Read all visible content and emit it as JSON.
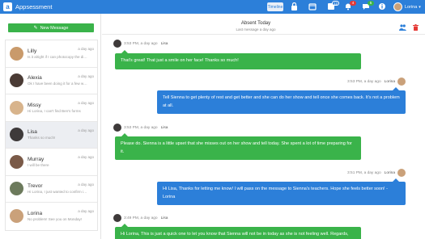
{
  "app": {
    "name": "Appsessment",
    "logo_letter": "a"
  },
  "topbar": {
    "timeline_label": "Timeline",
    "badges": {
      "notifications_a": "12",
      "notifications_b": "4",
      "messages": "5"
    },
    "user_name": "Lorina"
  },
  "sidebar": {
    "new_message_label": "New Message",
    "contacts": [
      {
        "name": "Lilly",
        "preview": "Is it alright if I can photocopy the dis...",
        "time": "a day ago"
      },
      {
        "name": "Alexia",
        "preview": "Ok I have been doing it for a few weeks...",
        "time": "a day ago"
      },
      {
        "name": "Missy",
        "preview": "Hi Lorina, I can't find Ben's forms",
        "time": "a day ago"
      },
      {
        "name": "Lisa",
        "preview": "Thanks so much!",
        "time": "a day ago"
      },
      {
        "name": "Murray",
        "preview": "I will be there",
        "time": "a day ago"
      },
      {
        "name": "Trevor",
        "preview": "Hi Lorina, I just wanted to confirm if we...",
        "time": "a day ago"
      },
      {
        "name": "Lorina",
        "preview": "No problem! See you on Monday!",
        "time": "a day ago"
      }
    ]
  },
  "chat": {
    "title": "Absent Today",
    "subtitle": "Last message a day ago",
    "messages": [
      {
        "dir": "in",
        "time": "3:53 PM, a day ago",
        "who": "Lisa",
        "text": "That's great! That just a smile on her face! Thanks so much!"
      },
      {
        "dir": "out",
        "time": "3:53 PM, a day ago",
        "who": "Lorina",
        "text": "Tell Sienna to get plenty of rest and get better and she can do her show and tell once she comes back. It's not a problem at all."
      },
      {
        "dir": "in",
        "time": "3:53 PM, a day ago",
        "who": "Lisa",
        "text": "Please do. Sienna is a little upset that she misses out on her show and tell today. She spent a lot of time preparing for it."
      },
      {
        "dir": "out",
        "time": "3:51 PM, a day ago",
        "who": "Lorina",
        "text": "Hi Lisa, Thanks for letting me know! I will pass on the message to Sienna's teachers. Hope she feels better soon! - Lorina"
      },
      {
        "dir": "in",
        "time": "3:49 PM, a day ago",
        "who": "Lisa",
        "text": "Hi Lorina, This is just a quick one to let you know that Sienna will not be in today as she is not feeling well. Regards,"
      }
    ]
  },
  "colors": {
    "brand_blue": "#2c7fd9",
    "incoming_green": "#3ab34a",
    "badge_blue": "#2c7fd9",
    "badge_red": "#e53935",
    "badge_green": "#3ab34a"
  },
  "icons": {
    "top": [
      "timeline-icon",
      "lock-icon",
      "calendar-icon",
      "expand-icon",
      "bell-icon",
      "chat-icon",
      "info-icon"
    ],
    "header": [
      "group-icon",
      "trash-icon"
    ],
    "new_message": "edit-icon"
  }
}
